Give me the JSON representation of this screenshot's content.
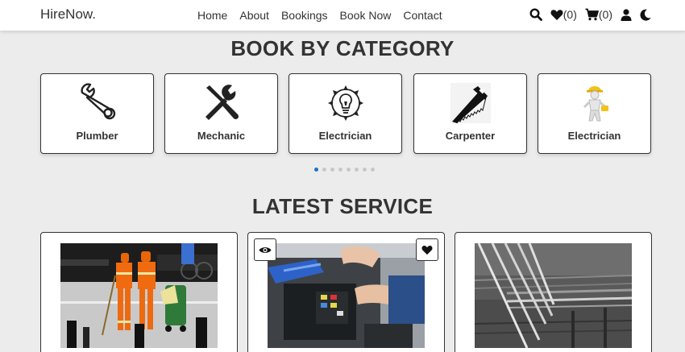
{
  "brand": {
    "name": "HireNow",
    "dot": "."
  },
  "nav": {
    "links": [
      "Home",
      "About",
      "Bookings",
      "Book Now",
      "Contact"
    ],
    "wishlist_count": "(0)",
    "cart_count": "(0)"
  },
  "icons": [
    "search-icon",
    "heart-icon",
    "cart-icon",
    "user-icon",
    "moon-icon",
    "wrench-icon",
    "tools-icon",
    "bulb-icon",
    "saw-icon",
    "worker-icon",
    "eye-icon"
  ],
  "category_section": {
    "title": "BOOK BY CATEGORY",
    "categories": [
      "Plumber",
      "Mechanic",
      "Electrician",
      "Carpenter",
      "Electrician"
    ],
    "carousel_pages": 8,
    "active_page": 1
  },
  "service_section": {
    "title": "LATEST SERVICE"
  },
  "colors": {
    "accent": "#1a73c8",
    "text": "#333333",
    "background": "#ececec"
  }
}
